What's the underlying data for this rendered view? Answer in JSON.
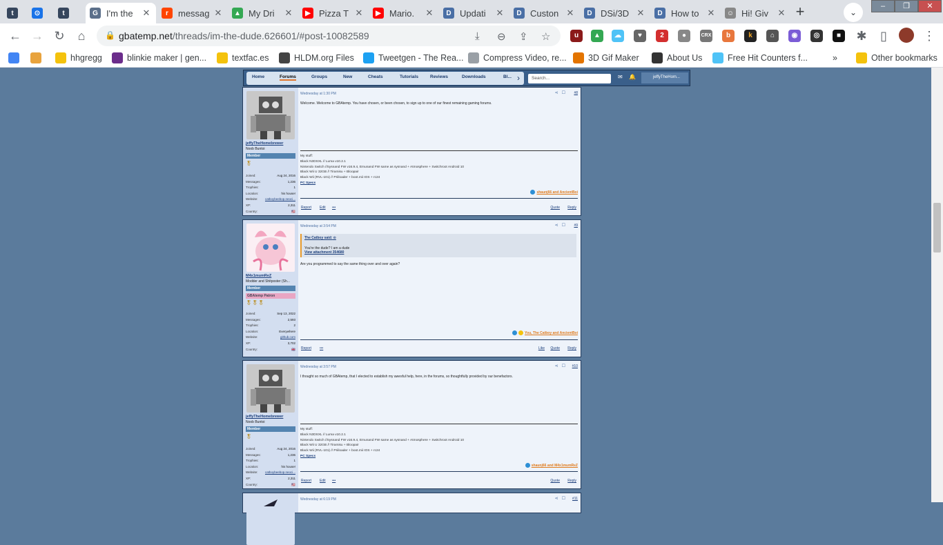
{
  "browser": {
    "tabs": [
      {
        "title": "",
        "favicon": "t",
        "color": "#36465d"
      },
      {
        "title": "",
        "favicon": "⊙",
        "color": "#1a73e8"
      },
      {
        "title": "",
        "favicon": "t",
        "color": "#36465d"
      },
      {
        "title": "I'm the",
        "favicon": "G",
        "color": "#5b6f8a"
      },
      {
        "title": "messag",
        "favicon": "r",
        "color": "#ff4500"
      },
      {
        "title": "My Dri",
        "favicon": "▲",
        "color": "#34a853"
      },
      {
        "title": "Pizza T",
        "favicon": "▶",
        "color": "#ff0000"
      },
      {
        "title": "Mario.",
        "favicon": "▶",
        "color": "#ff0000"
      },
      {
        "title": "Updati",
        "favicon": "D",
        "color": "#4a6fa5"
      },
      {
        "title": "Custon",
        "favicon": "D",
        "color": "#4a6fa5"
      },
      {
        "title": "DSi/3D",
        "favicon": "D",
        "color": "#4a6fa5"
      },
      {
        "title": "How to",
        "favicon": "D",
        "color": "#4a6fa5"
      },
      {
        "title": "Hi! Giv",
        "favicon": "☺",
        "color": "#888888"
      }
    ],
    "new_tab": "+",
    "tab_search": "⌄",
    "window_controls": [
      "–",
      "❐",
      "✕"
    ],
    "url_domain": "gbatemp.net",
    "url_path": "/threads/im-the-dude.626601/#post-10082589",
    "bookmarks": [
      {
        "label": "",
        "color": "#4285f4"
      },
      {
        "label": "",
        "color": "#e8a33d"
      },
      {
        "label": "hhgregg",
        "color": "#f4c20d"
      },
      {
        "label": "blinkie maker | gen...",
        "color": "#6b2d8b"
      },
      {
        "label": "textfac.es",
        "color": "#f4c20d"
      },
      {
        "label": "HLDM.org Files",
        "color": "#444444"
      },
      {
        "label": "Tweetgen - The Rea...",
        "color": "#1da1f2"
      },
      {
        "label": "Compress Video, re...",
        "color": "#9aa0a6"
      },
      {
        "label": "3D Gif Maker",
        "color": "#e37400"
      },
      {
        "label": "About Us",
        "color": "#333333"
      },
      {
        "label": "Free Hit Counters f...",
        "color": "#4fc3f7"
      }
    ],
    "bookmarks_more": "»",
    "other_bookmarks": "Other bookmarks"
  },
  "forum_nav": {
    "items": [
      "Home",
      "Forums",
      "Groups",
      "New",
      "Cheats",
      "Tutorials",
      "Reviews",
      "Downloads",
      "Bl..."
    ],
    "selected": "Forums",
    "search_placeholder": "Search...",
    "user": "jeffyTheHom..."
  },
  "posts": [
    {
      "date": "Wednesday at 1:30 PM",
      "number": "#8",
      "username": "jeffyTheHomebrewer",
      "user_title": "Noob Buntoi",
      "role": "Member",
      "stats": [
        {
          "k": "Joined:",
          "v": "Aug 24, 2016"
        },
        {
          "k": "Messages:",
          "v": "1,236"
        },
        {
          "k": "Trophies:",
          "v": "1"
        },
        {
          "k": "Location:",
          "v": "his house!"
        },
        {
          "k": "Website:",
          "v": "catboybeebop.neoci..."
        },
        {
          "k": "XP:",
          "v": "2,311"
        },
        {
          "k": "Country:",
          "v": "🇺🇸"
        }
      ],
      "body": "Welcome. Welcome to GBAtemp. You have chosen, or been chosen, to sign up to one of our finest remaining gaming forums.",
      "sig_label": "My stuff:",
      "sig": [
        "Black N3DSXL // Luma v10.2.1",
        "Nintendo Switch //Sysnand FW v16.9.4, Emunand FW same as sysnand + Atmosphere + Switchroot Android 10",
        "Black Wii U 32GB // Tiramisu + Bloopair",
        "Black Wii (RVL-101) // Priiloader + boot.mii IOS + rc24"
      ],
      "sig_spec": "PC Specs",
      "reactions": "shaunj66 and AncientBoi",
      "actions_left": [
        "Report",
        "Edit",
        "•••"
      ],
      "actions_right": [
        "Quote",
        "Reply"
      ]
    },
    {
      "date": "Wednesday at 3:54 PM",
      "number": "#9",
      "username": "M4x1mumReZ",
      "user_title": "Modder and Shitposter (Sh...",
      "role": "Member",
      "userbar": "GBAtemp Patron",
      "stats": [
        {
          "k": "Joined:",
          "v": "Sep 13, 2022"
        },
        {
          "k": "Messages:",
          "v": "2,593"
        },
        {
          "k": "Trophies:",
          "v": "2"
        },
        {
          "k": "Location:",
          "v": "Everywhere"
        },
        {
          "k": "Website:",
          "v": "github.com"
        },
        {
          "k": "XP:",
          "v": "3,702"
        },
        {
          "k": "Country:",
          "v": "🇬🇧"
        }
      ],
      "quote_header": "The Catboy said:",
      "quote_text": "You're the dude? I am a dude",
      "quote_attach": "View attachment 354680",
      "body": "Are you programmed to say the same thing over and over again?",
      "reactions": "You, The Catboy and AncientBoi",
      "actions_left": [
        "Report",
        "•••"
      ],
      "actions_right": [
        "Like",
        "Quote",
        "Reply"
      ]
    },
    {
      "date": "Wednesday at 3:57 PM",
      "number": "#10",
      "username": "jeffyTheHomebrewer",
      "user_title": "Noob Buntoi",
      "role": "Member",
      "stats": [
        {
          "k": "Joined:",
          "v": "Aug 24, 2016"
        },
        {
          "k": "Messages:",
          "v": "1,236"
        },
        {
          "k": "Trophies:",
          "v": "1"
        },
        {
          "k": "Location:",
          "v": "his house!"
        },
        {
          "k": "Website:",
          "v": "catboybeebop.neoci..."
        },
        {
          "k": "XP:",
          "v": "2,311"
        },
        {
          "k": "Country:",
          "v": "🇺🇸"
        }
      ],
      "body": "I thought so much of GBAtemp, that I elected to establish my awesful help, here, in the forums, so thoughtfully provided by our benefactors.",
      "sig_label": "My stuff:",
      "sig": [
        "Black N3DSXL // Luma v10.2.1",
        "Nintendo Switch //Sysnand FW v16.9.4, Emunand FW same as sysnand + Atmosphere + Switchroot Android 10",
        "Black Wii U 32GB // Tiramisu + Bloopair",
        "Black Wii (RVL-101) // Priiloader + boot.mii IOS + rc24"
      ],
      "sig_spec": "PC Specs",
      "reactions": "shaunj66 and M4x1mumReZ",
      "actions_left": [
        "Report",
        "Edit",
        "•••"
      ],
      "actions_right": [
        "Quote",
        "Reply"
      ]
    },
    {
      "date": "Wednesday at 6:19 PM",
      "number": "#11"
    }
  ]
}
